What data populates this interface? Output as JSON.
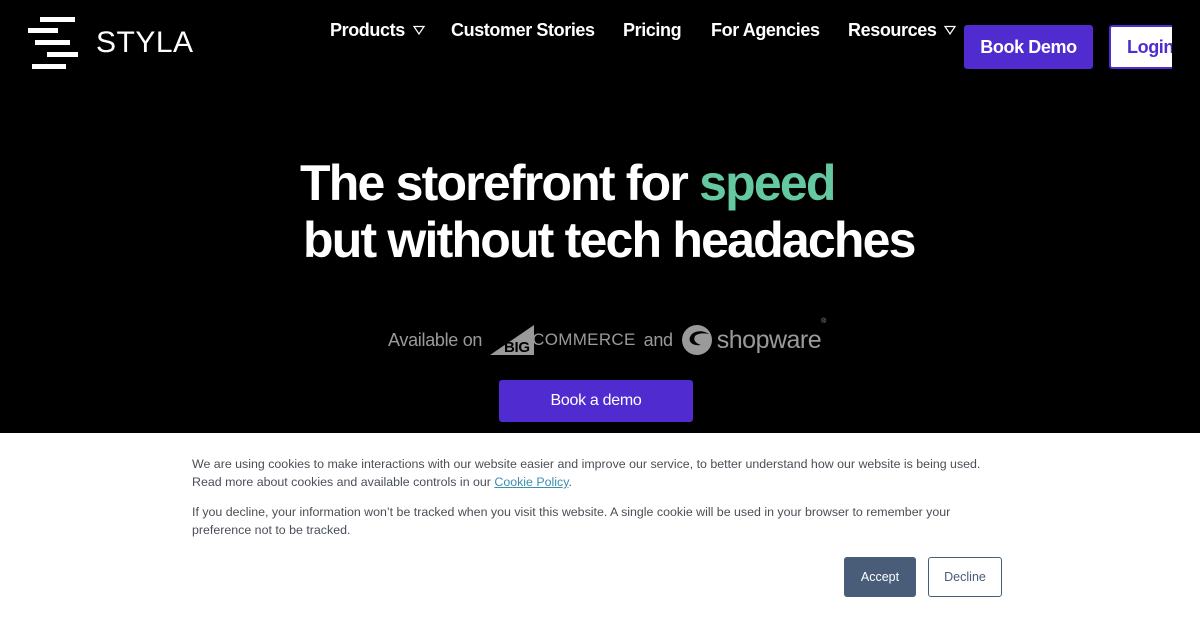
{
  "brand": {
    "name": "STYLA",
    "logo_icon": "stacked-bars-icon"
  },
  "nav": {
    "items": [
      {
        "label": "Products",
        "has_dropdown": true,
        "icon": "caret-down-icon"
      },
      {
        "label": "Customer Stories",
        "has_dropdown": false
      },
      {
        "label": "Pricing",
        "has_dropdown": false
      },
      {
        "label": "For Agencies",
        "has_dropdown": false
      },
      {
        "label": "Resources",
        "has_dropdown": true,
        "icon": "caret-down-icon"
      }
    ],
    "book_demo_label": "Book Demo",
    "login_label": "Login"
  },
  "hero": {
    "line1_prefix": "The storefront for ",
    "line1_accent": "speed",
    "line2": "but without tech headaches",
    "available_prefix": "Available on",
    "partner1_mark": "BIG",
    "partner1_word": "COMMERCE",
    "and_text": "and",
    "partner2_word": "shopware",
    "partner2_reg": "®",
    "cta_label": "Book a demo"
  },
  "cookie_banner": {
    "p1_text": "We are using cookies to make interactions with our website easier and improve our service, to better understand how our website is being used. Read more about cookies and available controls in our ",
    "p1_link": "Cookie Policy",
    "p1_end": ".",
    "p2_text": "If you decline, your information won’t be tracked when you visit this website. A single cookie will be used in your browser to remember your preference not to be tracked.",
    "accept_label": "Accept",
    "decline_label": "Decline"
  },
  "colors": {
    "background": "#000000",
    "primary": "#4f2bd0",
    "accent": "#64c8a0",
    "partner_logo_gray": "#9a9a9a",
    "cookie_button": "#495c78",
    "cookie_link": "#3b8fb0"
  }
}
